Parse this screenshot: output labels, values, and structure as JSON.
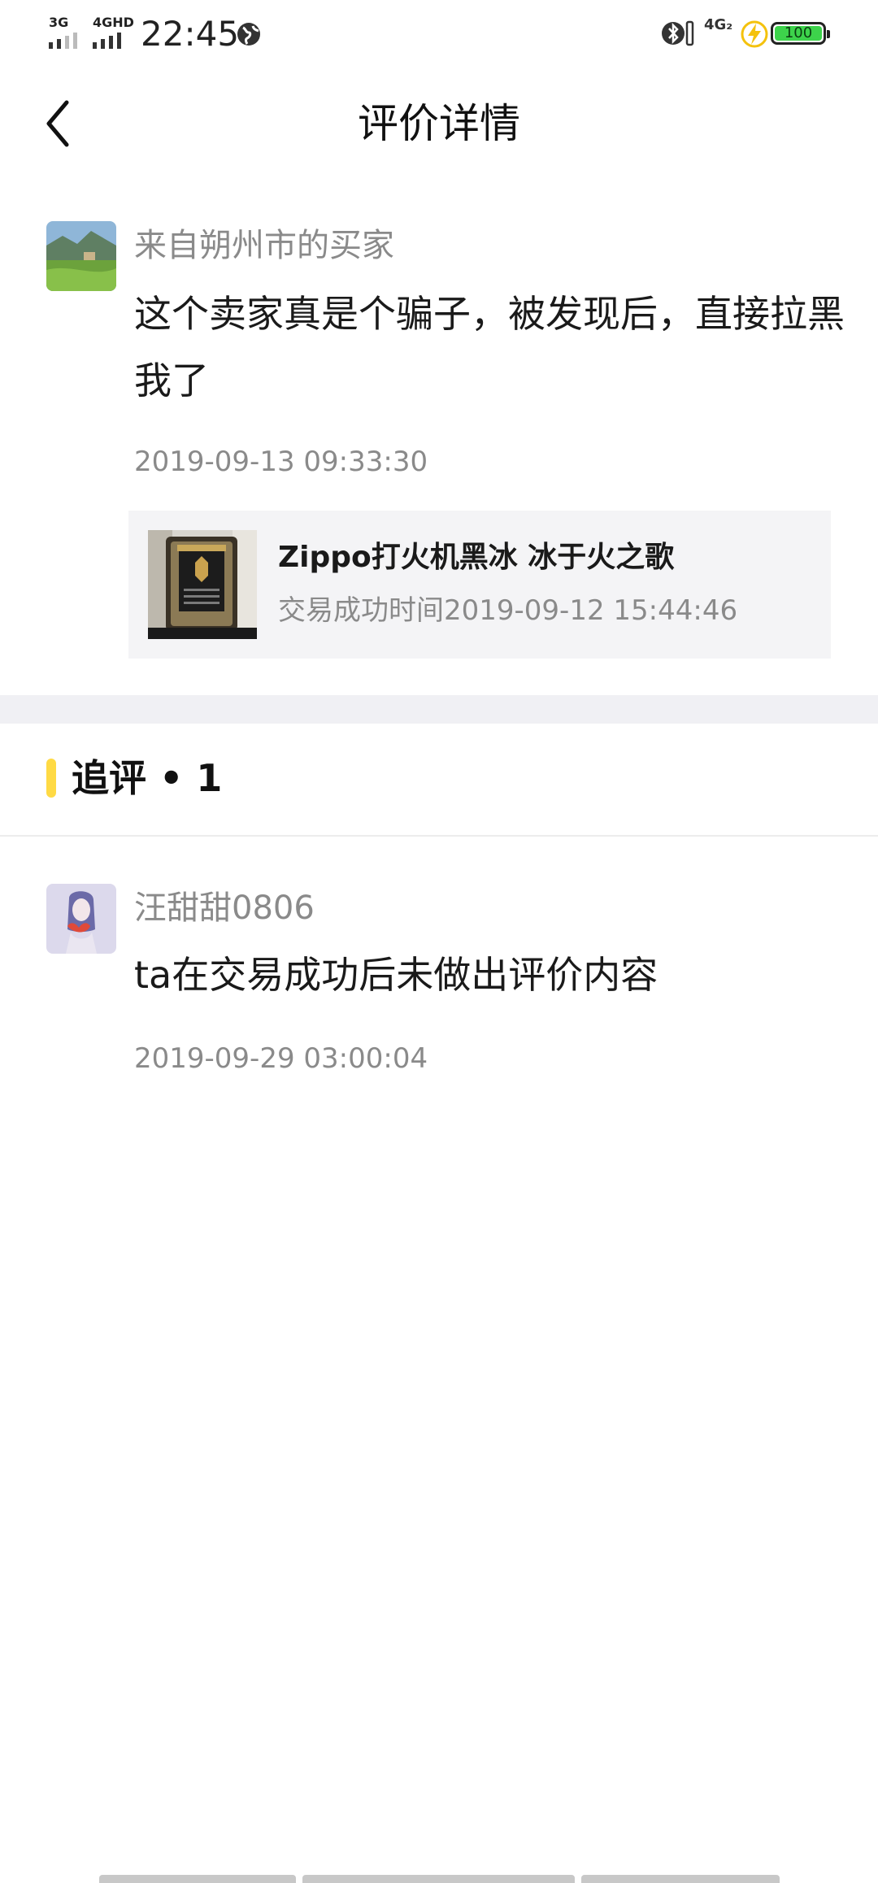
{
  "status_bar": {
    "signal1_label": "3G",
    "signal2_label": "4GHD",
    "time": "22:45",
    "network_label": "4G₂",
    "battery_level": "100"
  },
  "nav": {
    "title": "评价详情"
  },
  "review": {
    "reviewer_name": "来自朔州市的买家",
    "content": "这个卖家真是个骗子，被发现后，直接拉黑我了",
    "timestamp": "2019-09-13 09:33:30",
    "product": {
      "name": "Zippo打火机黑冰 冰于火之歌",
      "trade_time": "交易成功时间2019-09-12 15:44:46"
    }
  },
  "followup": {
    "label": "追评 • 1",
    "reviewer_name": "汪甜甜0806",
    "content": "ta在交易成功后未做出评价内容",
    "timestamp": "2019-09-29 03:00:04"
  },
  "colors": {
    "accent": "#ffda44",
    "muted_text": "#8a8a8a",
    "card_bg": "#f4f4f6",
    "battery_green": "#3dd34b"
  }
}
